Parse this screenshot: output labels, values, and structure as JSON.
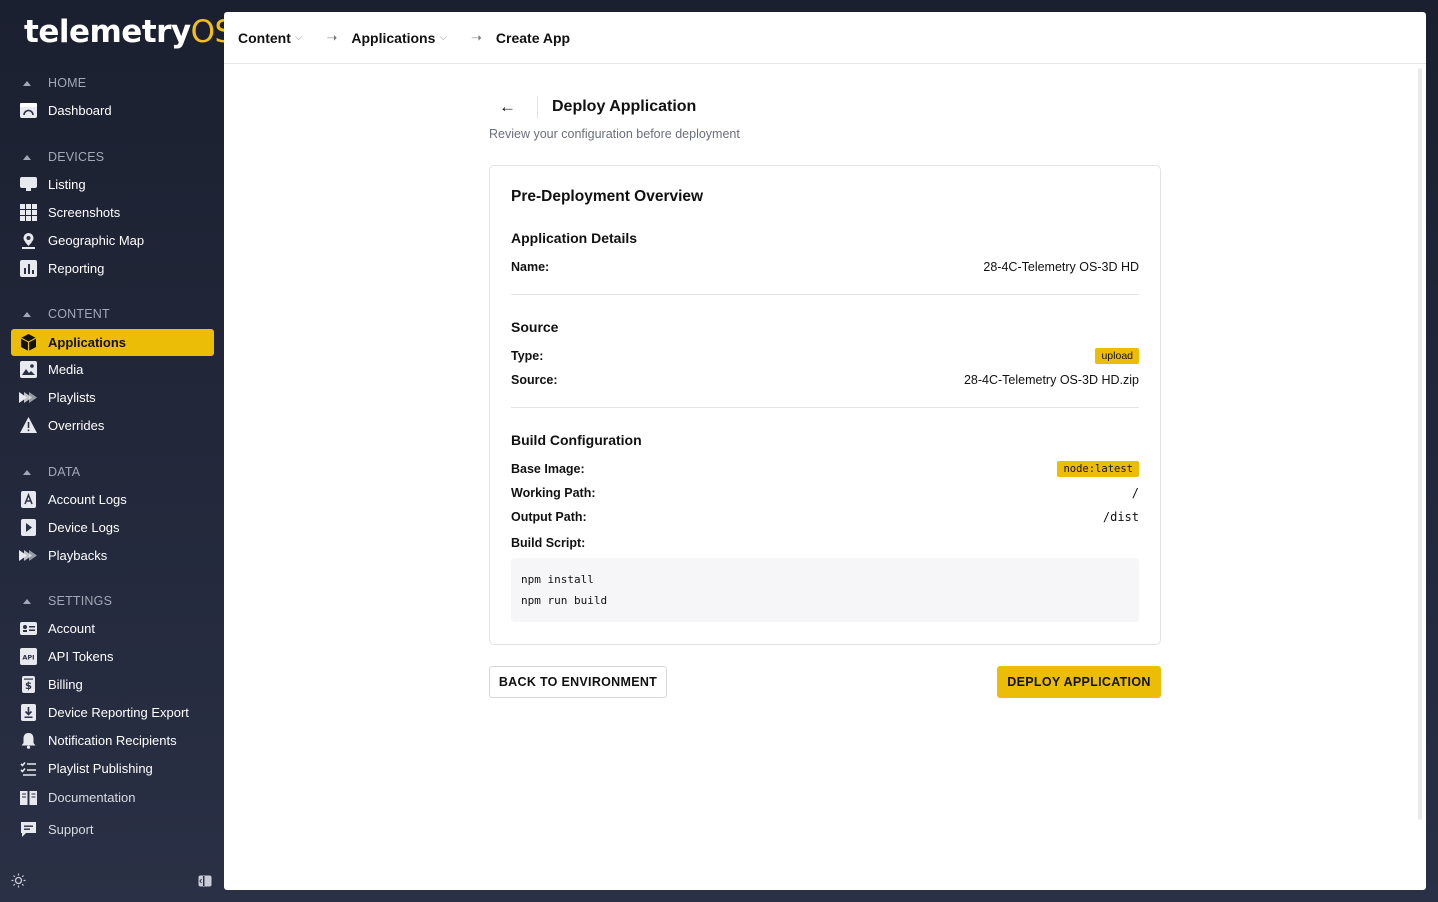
{
  "app": {
    "logo_main": "telemetry",
    "logo_accent": "OS",
    "accent_color": "#ebbd06"
  },
  "sidebar": {
    "sections": [
      {
        "label": "HOME",
        "items": [
          {
            "label": "Dashboard",
            "icon": "dashboard-icon"
          }
        ]
      },
      {
        "label": "DEVICES",
        "items": [
          {
            "label": "Listing",
            "icon": "monitor-icon"
          },
          {
            "label": "Screenshots",
            "icon": "grid-icon"
          },
          {
            "label": "Geographic Map",
            "icon": "map-pin-icon"
          },
          {
            "label": "Reporting",
            "icon": "bar-chart-icon"
          }
        ]
      },
      {
        "label": "CONTENT",
        "items": [
          {
            "label": "Applications",
            "icon": "cube-icon",
            "active": true
          },
          {
            "label": "Media",
            "icon": "image-icon"
          },
          {
            "label": "Playlists",
            "icon": "playlist-icon"
          },
          {
            "label": "Overrides",
            "icon": "warning-icon"
          }
        ]
      },
      {
        "label": "DATA",
        "items": [
          {
            "label": "Account Logs",
            "icon": "account-log-icon"
          },
          {
            "label": "Device Logs",
            "icon": "device-log-icon"
          },
          {
            "label": "Playbacks",
            "icon": "playback-icon"
          }
        ]
      },
      {
        "label": "SETTINGS",
        "items": [
          {
            "label": "Account",
            "icon": "id-card-icon"
          },
          {
            "label": "API Tokens",
            "icon": "api-icon"
          },
          {
            "label": "Billing",
            "icon": "billing-icon"
          },
          {
            "label": "Device Reporting Export",
            "icon": "download-icon"
          },
          {
            "label": "Notification Recipients",
            "icon": "bell-icon"
          },
          {
            "label": "Playlist Publishing",
            "icon": "checklist-icon"
          }
        ]
      }
    ],
    "footer_items": [
      {
        "label": "Documentation",
        "icon": "book-icon"
      },
      {
        "label": "Support",
        "icon": "chat-icon"
      }
    ]
  },
  "breadcrumb": {
    "content": "Content",
    "applications": "Applications",
    "create_app": "Create App"
  },
  "page": {
    "title": "Deploy Application",
    "subtitle": "Review your configuration before deployment",
    "back_arrow": "←"
  },
  "overview": {
    "title": "Pre-Deployment Overview",
    "app_details": {
      "heading": "Application Details",
      "name_label": "Name:",
      "name_value": "28-4C-Telemetry OS-3D HD"
    },
    "source": {
      "heading": "Source",
      "type_label": "Type:",
      "type_value": "upload",
      "source_label": "Source:",
      "source_value": "28-4C-Telemetry OS-3D HD.zip"
    },
    "build": {
      "heading": "Build Configuration",
      "base_image_label": "Base Image:",
      "base_image_value": "node:latest",
      "working_path_label": "Working Path:",
      "working_path_value": "/",
      "output_path_label": "Output Path:",
      "output_path_value": "/dist",
      "script_label": "Build Script:",
      "script_lines": [
        "npm install",
        "npm run build"
      ]
    }
  },
  "actions": {
    "back_label": "BACK TO ENVIRONMENT",
    "deploy_label": "DEPLOY APPLICATION"
  }
}
